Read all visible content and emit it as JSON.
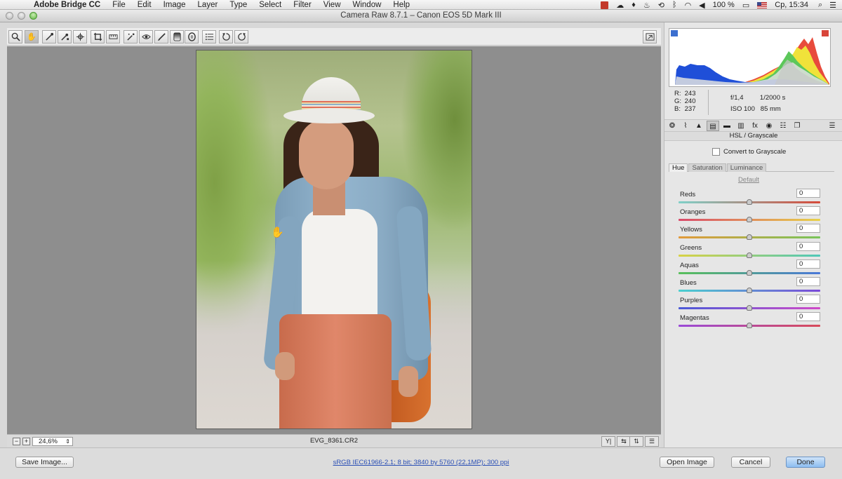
{
  "menubar": {
    "app_name": "Adobe Bridge CC",
    "menus": [
      "File",
      "Edit",
      "Image",
      "Layer",
      "Type",
      "Select",
      "Filter",
      "View",
      "Window",
      "Help"
    ],
    "battery": "100 %",
    "clock": "Ср, 15:34"
  },
  "window": {
    "title": "Camera Raw 8.7.1  –  Canon EOS 5D Mark III"
  },
  "toolbar": {
    "tools": [
      "zoom-tool",
      "hand-tool",
      "white-balance-tool",
      "color-sampler-tool",
      "targeted-adjustment-tool",
      "crop-tool",
      "straighten-tool",
      "spot-removal-tool",
      "red-eye-removal-tool",
      "adjustment-brush",
      "graduated-filter",
      "radial-filter",
      "preferences",
      "rotate-ccw",
      "rotate-cw"
    ],
    "active_tool": "hand-tool"
  },
  "status": {
    "zoom_out": "−",
    "zoom_in": "+",
    "zoom_level": "24,6%",
    "filename": "EVG_8361.CR2"
  },
  "histogram": {
    "readout": {
      "r_label": "R:",
      "r": "243",
      "g_label": "G:",
      "g": "240",
      "b_label": "B:",
      "b": "237"
    },
    "exif": {
      "aperture": "f/1,4",
      "shutter": "1/2000 s",
      "iso": "ISO 100",
      "focal": "85 mm"
    }
  },
  "panel": {
    "title": "HSL / Grayscale",
    "convert_grayscale": "Convert to Grayscale",
    "subtabs": [
      "Hue",
      "Saturation",
      "Luminance"
    ],
    "active_subtab": "Hue",
    "default_link": "Default",
    "sliders": [
      {
        "label": "Reds",
        "value": "0",
        "colors": [
          "#7fd0c8",
          "#d64a3a"
        ]
      },
      {
        "label": "Oranges",
        "value": "0",
        "colors": [
          "#d94a6a",
          "#e8d24a"
        ]
      },
      {
        "label": "Yellows",
        "value": "0",
        "colors": [
          "#e39a3a",
          "#78c45a"
        ]
      },
      {
        "label": "Greens",
        "value": "0",
        "colors": [
          "#d8d244",
          "#4ec8b8"
        ]
      },
      {
        "label": "Aquas",
        "value": "0",
        "colors": [
          "#58c05a",
          "#4a78d8"
        ]
      },
      {
        "label": "Blues",
        "value": "0",
        "colors": [
          "#4ad0d0",
          "#7a4ad8"
        ]
      },
      {
        "label": "Purples",
        "value": "0",
        "colors": [
          "#4a5ad8",
          "#d04ac8"
        ]
      },
      {
        "label": "Magentas",
        "value": "0",
        "colors": [
          "#9a4ad8",
          "#d84a5a"
        ]
      }
    ]
  },
  "bottom": {
    "save_image": "Save Image...",
    "workflow": "sRGB IEC61966-2.1; 8 bit; 3840 by 5760 (22,1MP); 300 ppi",
    "open_image": "Open Image",
    "cancel": "Cancel",
    "done": "Done"
  }
}
